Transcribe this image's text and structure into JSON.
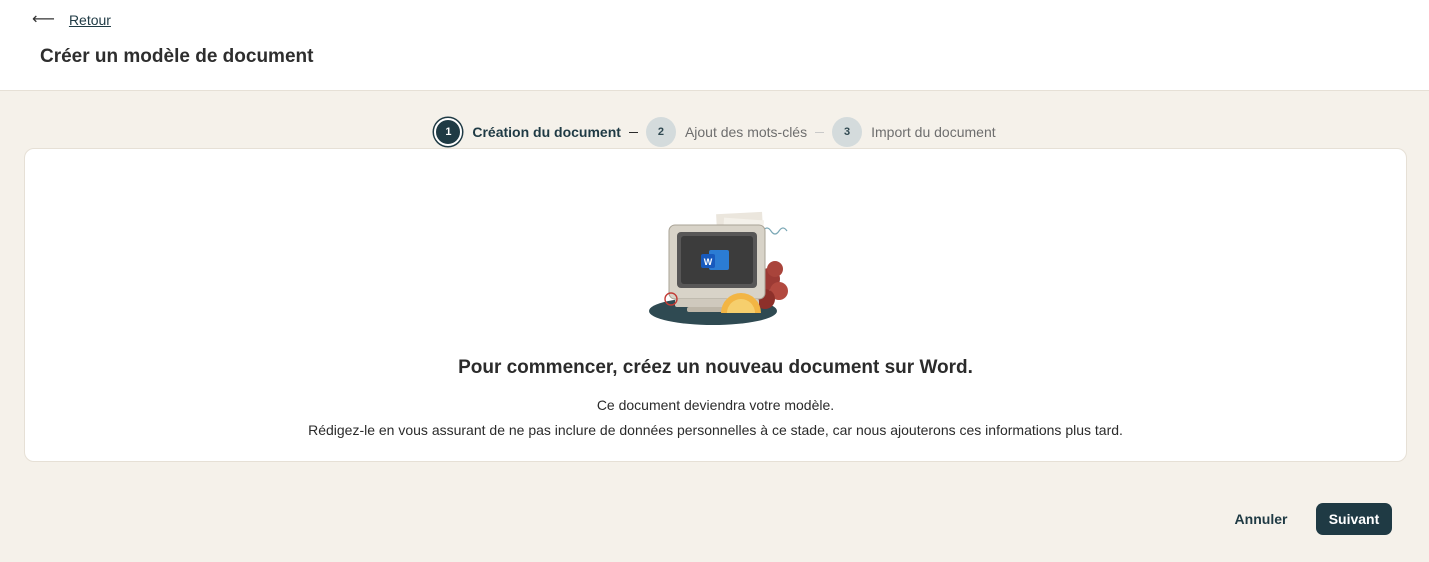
{
  "header": {
    "back_label": "Retour",
    "title": "Créer un modèle de document"
  },
  "stepper": {
    "steps": [
      {
        "number": "1",
        "label": "Création du document",
        "state": "active"
      },
      {
        "number": "2",
        "label": "Ajout des mots-clés",
        "state": "upcoming"
      },
      {
        "number": "3",
        "label": "Import du document",
        "state": "upcoming"
      }
    ]
  },
  "card": {
    "illustration_icon": "computer-word-icon",
    "title": "Pour commencer, créez un nouveau document sur Word.",
    "line1": "Ce document deviendra votre modèle.",
    "line2": "Rédigez-le en vous assurant de ne pas inclure de données personnelles à ce stade, car nous ajouterons ces informations plus tard."
  },
  "footer": {
    "cancel_label": "Annuler",
    "next_label": "Suivant"
  },
  "colors": {
    "primary": "#1f3a44",
    "background": "#f5f1ea",
    "card": "#ffffff",
    "step_inactive": "#d4dbdc"
  }
}
